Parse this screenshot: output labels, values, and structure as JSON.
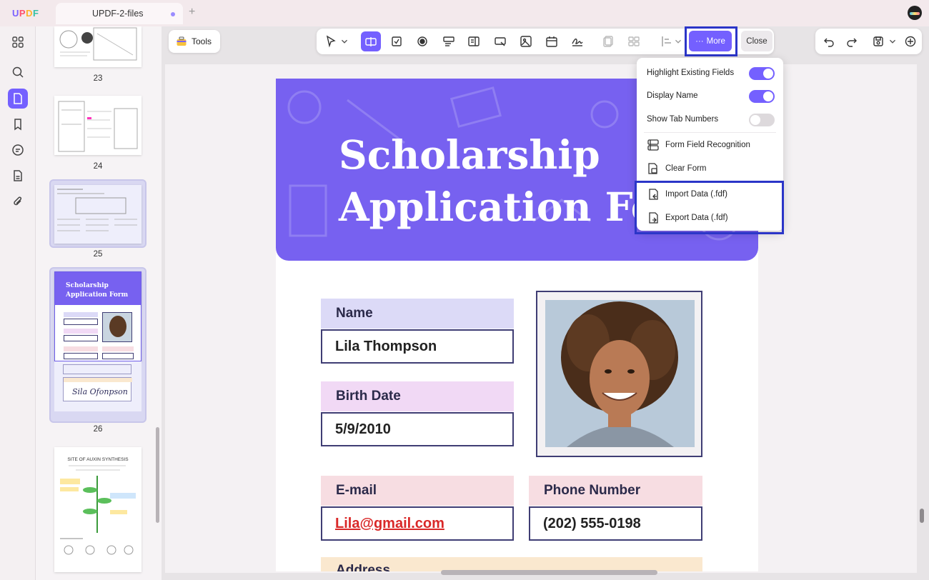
{
  "app": {
    "logo": "UPDF",
    "tab_title": "UPDF-2-files"
  },
  "sidebar": {
    "items": [
      {
        "name": "thumbnails-icon"
      },
      {
        "name": "search-icon"
      },
      {
        "name": "pages-icon",
        "active": true
      },
      {
        "name": "bookmark-icon"
      },
      {
        "name": "comment-icon"
      },
      {
        "name": "form-icon"
      },
      {
        "name": "attachment-icon"
      }
    ]
  },
  "thumbnails": {
    "pages": [
      {
        "number": "23"
      },
      {
        "number": "24"
      },
      {
        "number": "25"
      },
      {
        "number": "26",
        "title_line1": "Scholarship",
        "title_line2": "Application Form",
        "signature": "Sila Ofonpson"
      },
      {
        "number": "",
        "title": "SITE OF AUXIN SYNTHESIS"
      }
    ]
  },
  "toolbar": {
    "tools_label": "Tools",
    "more_label": "More",
    "close_label": "Close"
  },
  "more_menu": {
    "highlight_existing_fields": {
      "label": "Highlight Existing Fields",
      "on": true
    },
    "display_name": {
      "label": "Display Name",
      "on": true
    },
    "show_tab_numbers": {
      "label": "Show Tab Numbers",
      "on": false
    },
    "form_field_recognition": "Form Field Recognition",
    "clear_form": "Clear Form",
    "import_data": "Import Data (.fdf)",
    "export_data": "Export Data (.fdf)"
  },
  "document": {
    "title_line1": "Scholarship",
    "title_line2": "Application Form",
    "fields": {
      "name_label": "Name",
      "name_value": "Lila Thompson",
      "birth_label": "Birth Date",
      "birth_value": "5/9/2010",
      "email_label": "E-mail",
      "email_value": "Lila@gmail.com",
      "phone_label": "Phone Number",
      "phone_value": "(202) 555-0198",
      "address_label": "Address"
    }
  },
  "colors": {
    "accent": "#7460ff",
    "banner": "#7761f0",
    "highlight_border": "#2b35c8",
    "name_label_bg": "#dcdaf7",
    "birth_label_bg": "#f1d9f5",
    "email_label_bg": "#f7dde2",
    "phone_label_bg": "#f7dde2",
    "address_label_bg": "#fae8cf",
    "email_text": "#d92828"
  }
}
